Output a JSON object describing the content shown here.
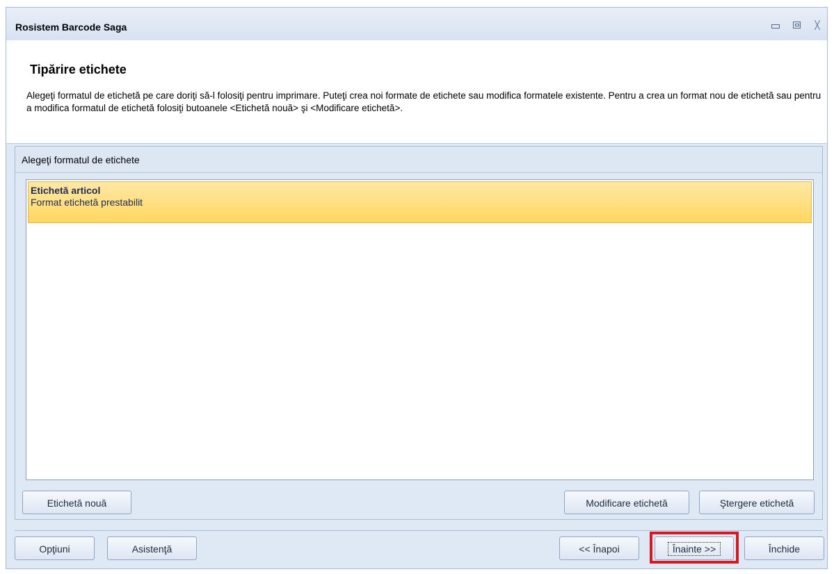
{
  "window": {
    "title": "Rosistem Barcode Saga"
  },
  "header": {
    "title": "Tipărire etichete",
    "description": "Alegeţi formatul de etichetă pe care doriţi să-l folosiţi pentru imprimare. Puteţi crea noi formate de etichete sau modifica formatele existente. Pentru a crea un format nou de etichetă sau pentru a modifica formatul de etichetă folosiţi butoanele <Etichetă nouă> şi <Modificare etichetă>."
  },
  "panel": {
    "caption": "Alegeţi formatul de etichete",
    "items": [
      {
        "name": "Etichetă articol",
        "description": "Format etichetă prestabilit",
        "selected": true
      }
    ]
  },
  "label_actions": {
    "new_label": "Etichetă nouă",
    "modify_label": "Modificare etichetă",
    "delete_label": "Ştergere etichetă"
  },
  "footer": {
    "options": "Opţiuni",
    "help": "Asistenţă",
    "back": "<< Înapoi",
    "next": "Înainte >>",
    "close": "Închide"
  },
  "colors": {
    "window_bg": "#dfe8f5",
    "selection": "#ffd860",
    "highlight_border": "#d71a21"
  },
  "icons": {
    "minimize": "minimize-icon",
    "restore": "restore-icon",
    "close": "close-icon"
  }
}
